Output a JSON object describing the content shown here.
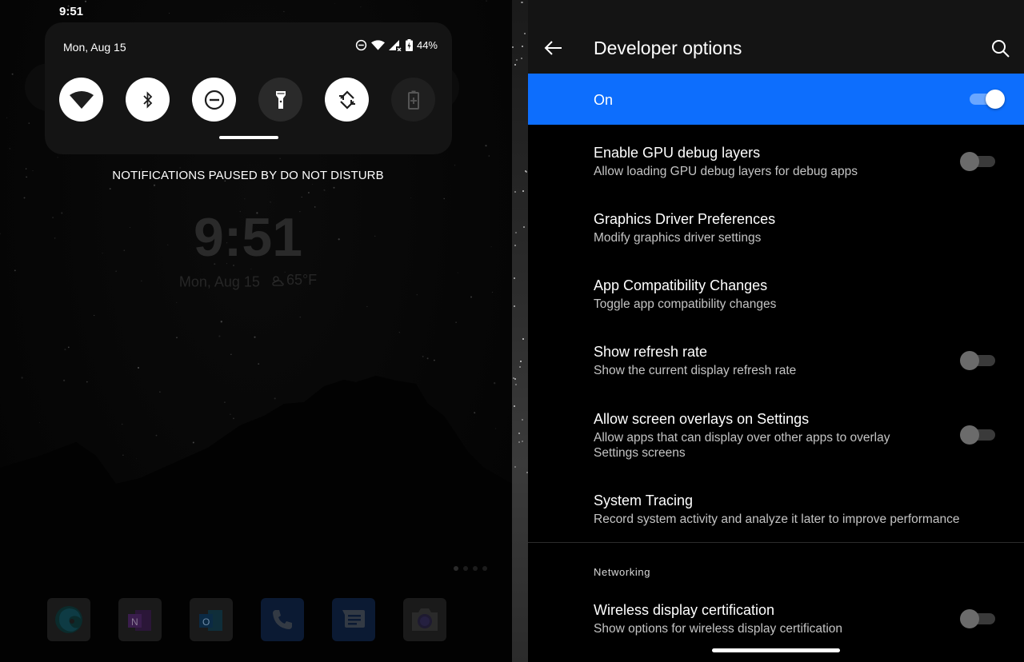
{
  "left": {
    "status_bar_time": "9:51",
    "quick_settings": {
      "date": "Mon, Aug 15",
      "status_icons": [
        "dnd-icon",
        "wifi-icon",
        "cell-signal-no-service-icon",
        "battery-charging-icon"
      ],
      "battery_percent": "44%",
      "tiles": [
        {
          "name": "wifi",
          "icon": "wifi-icon",
          "state": "on"
        },
        {
          "name": "bluetooth",
          "icon": "bluetooth-icon",
          "state": "on"
        },
        {
          "name": "do-not-disturb",
          "icon": "dnd-icon",
          "state": "on"
        },
        {
          "name": "flashlight",
          "icon": "flashlight-icon",
          "state": "off"
        },
        {
          "name": "auto-rotate",
          "icon": "auto-rotate-icon",
          "state": "on"
        },
        {
          "name": "battery-saver",
          "icon": "battery-saver-icon",
          "state": "disabled"
        }
      ]
    },
    "dnd_message": "NOTIFICATIONS PAUSED BY DO NOT DISTURB",
    "lock_clock": "9:51",
    "lock_date": "Mon, Aug 15",
    "weather_temp": "65°F",
    "weather_icon": "partly-cloudy-icon",
    "page_indicator": {
      "count": 4,
      "active": 1
    },
    "dock_apps": [
      {
        "name": "Edge",
        "icon": "edge-icon"
      },
      {
        "name": "OneNote",
        "icon": "onenote-icon"
      },
      {
        "name": "Outlook",
        "icon": "outlook-icon"
      },
      {
        "name": "Phone",
        "icon": "phone-icon"
      },
      {
        "name": "Messages",
        "icon": "messages-icon"
      },
      {
        "name": "Camera",
        "icon": "camera-icon"
      }
    ]
  },
  "settings": {
    "title": "Developer options",
    "master_switch": {
      "label": "On",
      "checked": true
    },
    "accent_color": "#0d6efd",
    "items": [
      {
        "title": "Enable GPU debug layers",
        "summary": "Allow loading GPU debug layers for debug apps",
        "has_switch": true,
        "checked": false
      },
      {
        "title": "Graphics Driver Preferences",
        "summary": "Modify graphics driver settings",
        "has_switch": false
      },
      {
        "title": "App Compatibility Changes",
        "summary": "Toggle app compatibility changes",
        "has_switch": false
      },
      {
        "title": "Show refresh rate",
        "summary": "Show the current display refresh rate",
        "has_switch": true,
        "checked": false
      },
      {
        "title": "Allow screen overlays on Settings",
        "summary": "Allow apps that can display over other apps to overlay Settings screens",
        "has_switch": true,
        "checked": false
      },
      {
        "title": "System Tracing",
        "summary": "Record system activity and analyze it later to improve performance",
        "has_switch": false
      }
    ],
    "category": "Networking",
    "network_items": [
      {
        "title": "Wireless display certification",
        "summary": "Show options for wireless display certification",
        "has_switch": true,
        "checked": false
      }
    ]
  }
}
